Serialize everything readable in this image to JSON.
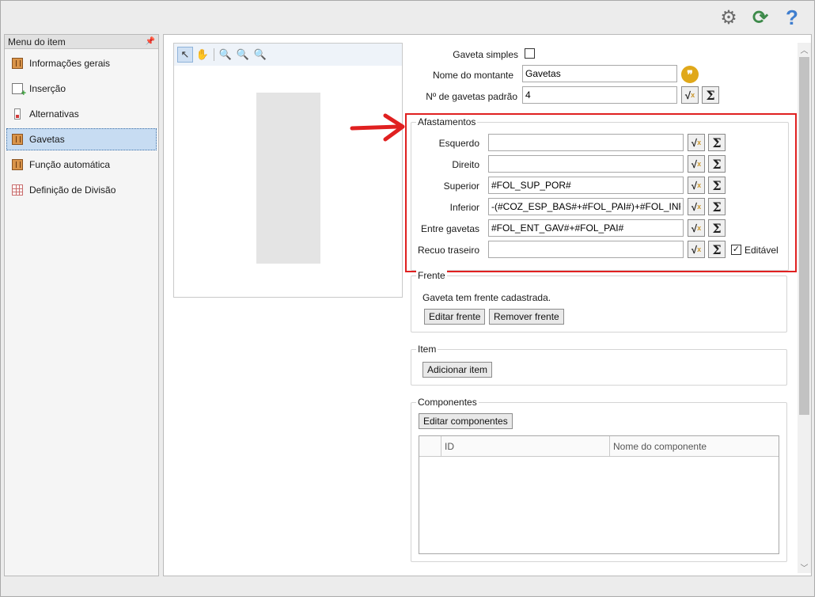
{
  "toolbar": {
    "settings": "⚙",
    "refresh": "⟳",
    "help": "?"
  },
  "sidebar": {
    "header": "Menu do item",
    "items": [
      {
        "label": "Informações gerais"
      },
      {
        "label": "Inserção"
      },
      {
        "label": "Alternativas"
      },
      {
        "label": "Gavetas"
      },
      {
        "label": "Função automática"
      },
      {
        "label": "Definição de Divisão"
      }
    ]
  },
  "form": {
    "gaveta_simples_label": "Gaveta simples",
    "nome_montante_label": "Nome do montante",
    "nome_montante_value": "Gavetas",
    "num_gavetas_label": "Nº de gavetas padrão",
    "num_gavetas_value": "4"
  },
  "afastamentos": {
    "title": "Afastamentos",
    "esquerdo_label": "Esquerdo",
    "esquerdo_value": "",
    "direito_label": "Direito",
    "direito_value": "",
    "superior_label": "Superior",
    "superior_value": "#FOL_SUP_POR#",
    "inferior_label": "Inferior",
    "inferior_value": "-(#COZ_ESP_BAS#+#FOL_PAI#)+#FOL_INF_P",
    "entre_label": "Entre gavetas",
    "entre_value": "#FOL_ENT_GAV#+#FOL_PAI#",
    "recuo_label": "Recuo traseiro",
    "recuo_value": "",
    "editavel_label": "Editável"
  },
  "frente": {
    "title": "Frente",
    "message": "Gaveta tem frente cadastrada.",
    "edit_button": "Editar frente",
    "remove_button": "Remover frente"
  },
  "item": {
    "title": "Item",
    "add_button": "Adicionar item"
  },
  "componentes": {
    "title": "Componentes",
    "edit_button": "Editar componentes",
    "columns": [
      "ID",
      "Nome do componente"
    ]
  },
  "colors": {
    "highlight": "#e02020",
    "accent": "#3d6fa6"
  }
}
